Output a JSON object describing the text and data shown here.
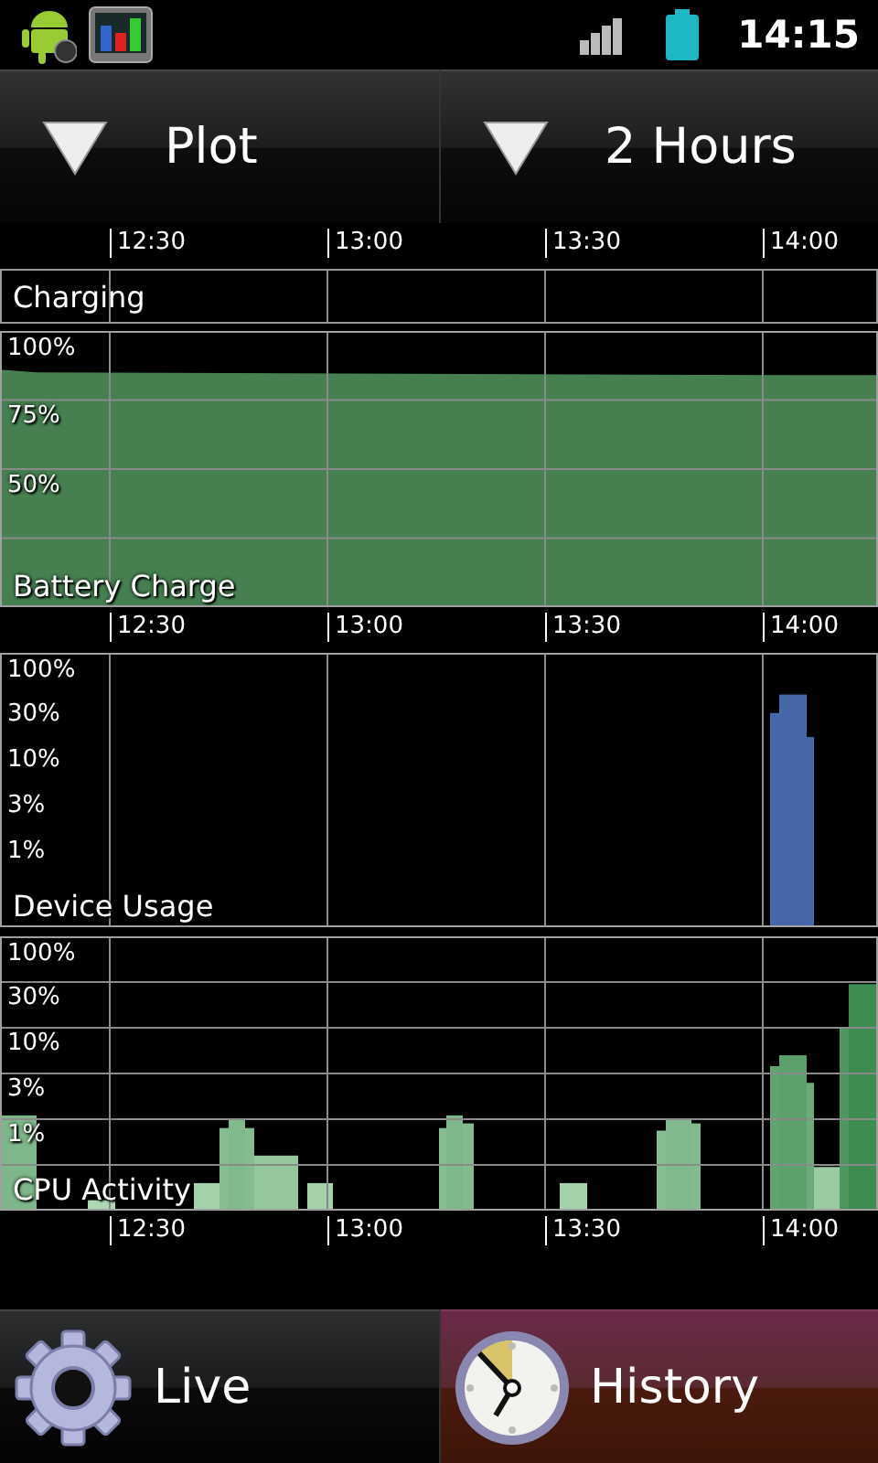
{
  "status_bar": {
    "time": "14:15"
  },
  "spinners": [
    {
      "label": "Plot"
    },
    {
      "label": "2 Hours"
    }
  ],
  "time_axes": [
    {
      "labels": [
        "12:30",
        "13:00",
        "13:30",
        "14:00"
      ]
    },
    {
      "labels": [
        "12:30",
        "13:00",
        "13:30",
        "14:00"
      ]
    },
    {
      "labels": [
        "12:30",
        "13:00",
        "13:30",
        "14:00"
      ]
    }
  ],
  "charging": {
    "label": "Charging"
  },
  "charts": [
    {
      "kind": "battery",
      "title": "Battery Charge",
      "horizontal_grid": true,
      "y_labels": [
        "100%",
        "75%",
        "50%"
      ]
    },
    {
      "kind": "usage",
      "title": "Device Usage",
      "horizontal_grid": false,
      "y_labels": [
        "100%",
        "30%",
        "10%",
        "3%",
        "1%"
      ]
    },
    {
      "kind": "cpu",
      "title": "CPU Activity",
      "horizontal_grid": true,
      "y_labels": [
        "100%",
        "30%",
        "10%",
        "3%",
        "1%"
      ]
    }
  ],
  "tabs": [
    {
      "label": "Live",
      "kind": "gear",
      "selected": false
    },
    {
      "label": "History",
      "kind": "clock",
      "selected": true
    }
  ]
}
